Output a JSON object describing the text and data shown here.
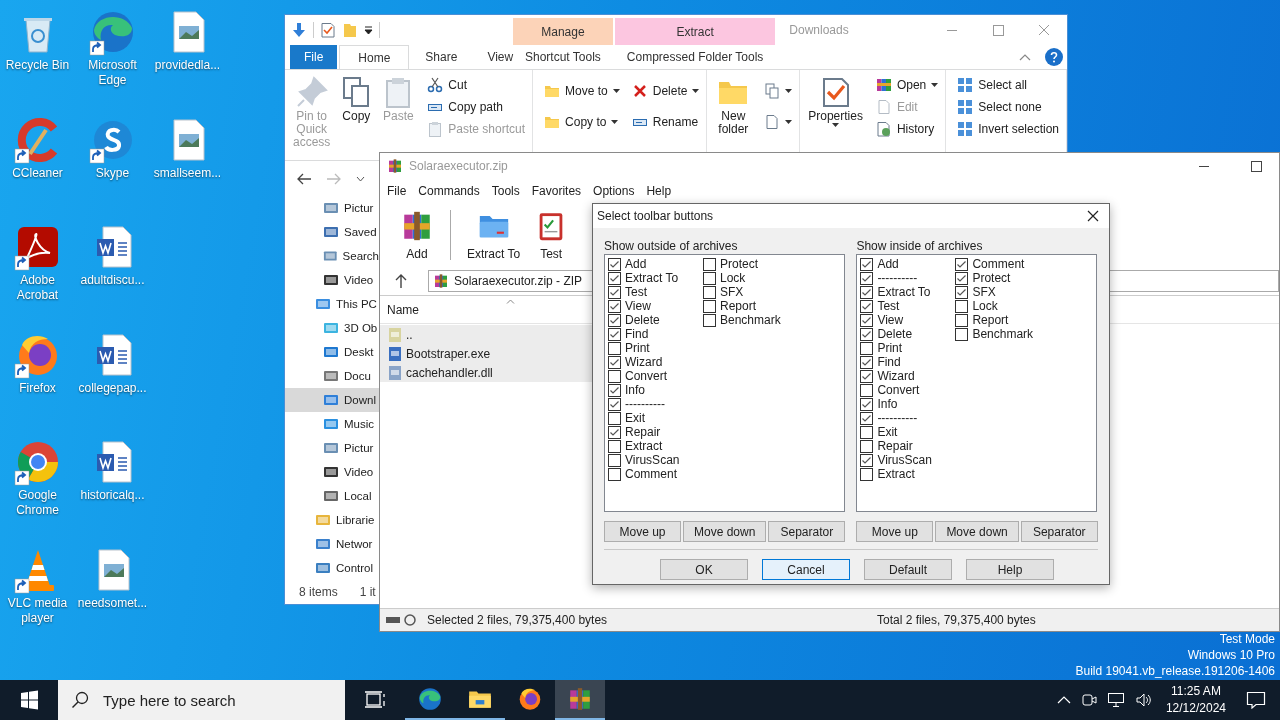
{
  "desktop": {
    "icons": [
      {
        "label": "Recycle Bin",
        "kind": "recycle",
        "shortcut": false
      },
      {
        "label": "CCleaner",
        "kind": "ccleaner",
        "shortcut": true
      },
      {
        "label": "Adobe Acrobat",
        "kind": "acrobat",
        "shortcut": true
      },
      {
        "label": "Firefox",
        "kind": "firefox",
        "shortcut": true
      },
      {
        "label": "Google Chrome",
        "kind": "chrome",
        "shortcut": true
      },
      {
        "label": "VLC media player",
        "kind": "vlc",
        "shortcut": true
      },
      {
        "label": "Microsoft Edge",
        "kind": "edge",
        "shortcut": true
      },
      {
        "label": "Skype",
        "kind": "skype",
        "shortcut": true
      },
      {
        "label": "adultdiscu...",
        "kind": "word",
        "shortcut": false
      },
      {
        "label": "collegepap...",
        "kind": "word",
        "shortcut": false
      },
      {
        "label": "historicalq...",
        "kind": "word",
        "shortcut": false
      },
      {
        "label": "needsomet...",
        "kind": "image",
        "shortcut": false
      },
      {
        "label": "providedla...",
        "kind": "image",
        "shortcut": false
      },
      {
        "label": "smallseem...",
        "kind": "image",
        "shortcut": false
      }
    ],
    "system_text": [
      "Test Mode",
      "Windows 10 Pro",
      "Build 19041.vb_release.191206-1406"
    ]
  },
  "explorer": {
    "title": "Downloads",
    "tabs": [
      {
        "label": "File",
        "kind": "file",
        "selected": false
      },
      {
        "label": "Home",
        "kind": "tab",
        "selected": true
      },
      {
        "label": "Share",
        "kind": "tab",
        "selected": false
      },
      {
        "label": "View",
        "kind": "tab",
        "selected": false
      }
    ],
    "context_tabs": [
      {
        "header": "Manage",
        "label": "Shortcut Tools",
        "color": "#fcd3b8",
        "selected": false
      },
      {
        "header": "Extract",
        "label": "Compressed Folder Tools",
        "color": "#fcc6e0",
        "selected": false
      }
    ],
    "ribbon": {
      "groups": [
        {
          "columns": [
            {
              "kind": "large",
              "label": "Pin to Quick access",
              "disabled": true,
              "dropdown": false
            },
            {
              "kind": "large",
              "label": "Copy",
              "disabled": false,
              "dropdown": false
            },
            {
              "kind": "large",
              "label": "Paste",
              "disabled": true,
              "dropdown": false
            },
            {
              "kind": "stack",
              "items": [
                {
                  "label": "Cut",
                  "disabled": false,
                  "dropdown": false
                },
                {
                  "label": "Copy path",
                  "disabled": false,
                  "dropdown": false
                },
                {
                  "label": "Paste shortcut",
                  "disabled": true,
                  "dropdown": false
                }
              ]
            }
          ]
        },
        {
          "columns": [
            {
              "kind": "stack",
              "items": [
                {
                  "label": "Move to",
                  "disabled": false,
                  "dropdown": true
                },
                {
                  "label": "Copy to",
                  "disabled": false,
                  "dropdown": true
                }
              ]
            },
            {
              "kind": "stack",
              "items": [
                {
                  "label": "Delete",
                  "disabled": false,
                  "dropdown": true
                },
                {
                  "label": "Rename",
                  "disabled": false,
                  "dropdown": false
                }
              ]
            }
          ]
        },
        {
          "columns": [
            {
              "kind": "large",
              "label": "New folder",
              "disabled": false,
              "dropdown": false
            },
            {
              "kind": "stack",
              "items": [
                {
                  "disabled": false,
                  "dropdown": true
                },
                {
                  "disabled": false,
                  "dropdown": true
                }
              ]
            }
          ]
        },
        {
          "columns": [
            {
              "kind": "large",
              "label": "Properties",
              "disabled": false,
              "dropdown": true
            },
            {
              "kind": "stack",
              "items": [
                {
                  "label": "Open",
                  "disabled": false,
                  "dropdown": true
                },
                {
                  "label": "Edit",
                  "disabled": true,
                  "dropdown": false
                },
                {
                  "label": "History",
                  "disabled": false,
                  "dropdown": false
                }
              ]
            }
          ]
        },
        {
          "columns": [
            {
              "kind": "stack",
              "items": [
                {
                  "label": "Select all",
                  "disabled": false,
                  "dropdown": false
                },
                {
                  "label": "Select none",
                  "disabled": false,
                  "dropdown": false
                },
                {
                  "label": "Invert selection",
                  "disabled": false,
                  "dropdown": false
                }
              ]
            }
          ]
        }
      ]
    },
    "sidebar": {
      "items": [
        {
          "label": "Pictur",
          "kind": "place",
          "selected": false
        },
        {
          "label": "Saved",
          "kind": "place",
          "selected": false
        },
        {
          "label": "Search",
          "kind": "place",
          "selected": false
        },
        {
          "label": "Video",
          "kind": "place",
          "selected": false
        },
        {
          "label": "This PC",
          "kind": "root",
          "selected": false,
          "children": [
            {
              "label": "3D Ob",
              "selected": false
            },
            {
              "label": "Deskt",
              "selected": false
            },
            {
              "label": "Docu",
              "selected": false
            },
            {
              "label": "Downl",
              "selected": true
            },
            {
              "label": "Music",
              "selected": false
            },
            {
              "label": "Pictur",
              "selected": false
            },
            {
              "label": "Video",
              "selected": false
            },
            {
              "label": "Local",
              "selected": false
            }
          ]
        },
        {
          "label": "Librarie",
          "kind": "root",
          "selected": false
        },
        {
          "label": "Networ",
          "kind": "root",
          "selected": false
        },
        {
          "label": "Control",
          "kind": "root",
          "selected": false
        }
      ]
    },
    "status": [
      "8 items",
      "1 it"
    ]
  },
  "winrar": {
    "title": "Solaraexecutor.zip",
    "menu": [
      "File",
      "Commands",
      "Tools",
      "Favorites",
      "Options",
      "Help"
    ],
    "toolbar": [
      "Add",
      "Extract To",
      "Test"
    ],
    "address": "Solaraexecutor.zip - ZIP",
    "columns": [
      "Name"
    ],
    "files": [
      {
        "name": "..",
        "kind": "up",
        "selected": true
      },
      {
        "name": "Bootstraper.exe",
        "kind": "exe",
        "selected": true
      },
      {
        "name": "cachehandler.dll",
        "kind": "dll",
        "selected": true
      }
    ],
    "status_left": "Selected 2 files, 79,375,400 bytes",
    "status_right": "Total 2 files, 79,375,400 bytes"
  },
  "dialog": {
    "title": "Select toolbar buttons",
    "groups": [
      {
        "label": "Show outside of archives",
        "columns": [
          {
            "items": [
              {
                "label": "Add",
                "checked": true
              },
              {
                "label": "Extract To",
                "checked": true
              },
              {
                "label": "Test",
                "checked": true
              },
              {
                "label": "View",
                "checked": true
              },
              {
                "label": "Delete",
                "checked": true
              },
              {
                "label": "Find",
                "checked": true
              },
              {
                "label": "Print",
                "checked": false
              },
              {
                "label": "Wizard",
                "checked": true
              },
              {
                "label": "Convert",
                "checked": false
              },
              {
                "label": "Info",
                "checked": true
              },
              {
                "label": "----------",
                "checked": true
              },
              {
                "label": "Exit",
                "checked": false
              },
              {
                "label": "Repair",
                "checked": true
              },
              {
                "label": "Extract",
                "checked": false
              },
              {
                "label": "VirusScan",
                "checked": false
              },
              {
                "label": "Comment",
                "checked": false
              }
            ]
          },
          {
            "items": [
              {
                "label": "Protect",
                "checked": false
              },
              {
                "label": "Lock",
                "checked": false
              },
              {
                "label": "SFX",
                "checked": false
              },
              {
                "label": "Report",
                "checked": false
              },
              {
                "label": "Benchmark",
                "checked": false
              }
            ]
          }
        ],
        "buttons": [
          "Move up",
          "Move down",
          "Separator"
        ]
      },
      {
        "label": "Show inside of archives",
        "columns": [
          {
            "items": [
              {
                "label": "Add",
                "checked": true
              },
              {
                "label": "----------",
                "checked": true
              },
              {
                "label": "Extract To",
                "checked": true
              },
              {
                "label": "Test",
                "checked": true
              },
              {
                "label": "View",
                "checked": true
              },
              {
                "label": "Delete",
                "checked": true
              },
              {
                "label": "Print",
                "checked": false
              },
              {
                "label": "Find",
                "checked": true
              },
              {
                "label": "Wizard",
                "checked": true
              },
              {
                "label": "Convert",
                "checked": false
              },
              {
                "label": "Info",
                "checked": true
              },
              {
                "label": "----------",
                "checked": true
              },
              {
                "label": "Exit",
                "checked": false
              },
              {
                "label": "Repair",
                "checked": false
              },
              {
                "label": "VirusScan",
                "checked": true
              },
              {
                "label": "Extract",
                "checked": false
              }
            ]
          },
          {
            "items": [
              {
                "label": "Comment",
                "checked": true
              },
              {
                "label": "Protect",
                "checked": true
              },
              {
                "label": "SFX",
                "checked": true
              },
              {
                "label": "Lock",
                "checked": false
              },
              {
                "label": "Report",
                "checked": false
              },
              {
                "label": "Benchmark",
                "checked": false
              }
            ]
          }
        ],
        "buttons": [
          "Move up",
          "Move down",
          "Separator"
        ]
      }
    ],
    "buttons": [
      {
        "label": "OK",
        "default": false
      },
      {
        "label": "Cancel",
        "default": true
      },
      {
        "label": "Default",
        "default": false
      },
      {
        "label": "Help",
        "default": false
      }
    ]
  },
  "taskbar": {
    "search": {
      "placeholder": "Type here to search"
    },
    "apps": [
      {
        "kind": "edge",
        "running": true,
        "active": false
      },
      {
        "kind": "explorer",
        "running": true,
        "active": false
      },
      {
        "kind": "firefox",
        "running": false,
        "active": false
      },
      {
        "kind": "winrar",
        "running": true,
        "active": true
      }
    ],
    "time": "11:25 AM",
    "date": "12/12/2024"
  }
}
